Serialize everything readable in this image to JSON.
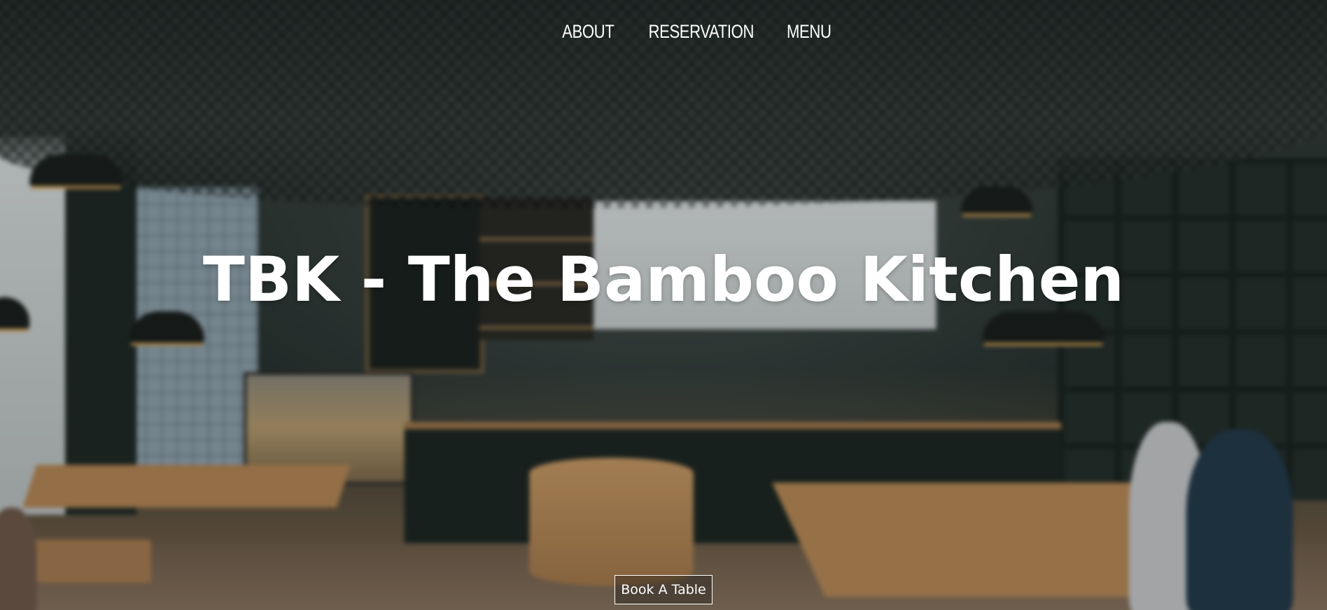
{
  "nav": {
    "items": [
      {
        "label": "ABOUT"
      },
      {
        "label": "RESERVATION"
      },
      {
        "label": "MENU"
      }
    ]
  },
  "hero": {
    "title": "TBK - The Bamboo Kitchen",
    "cta_label": "Book A Table"
  },
  "colors": {
    "text": "#ffffff",
    "button_border": "#ffffff"
  }
}
